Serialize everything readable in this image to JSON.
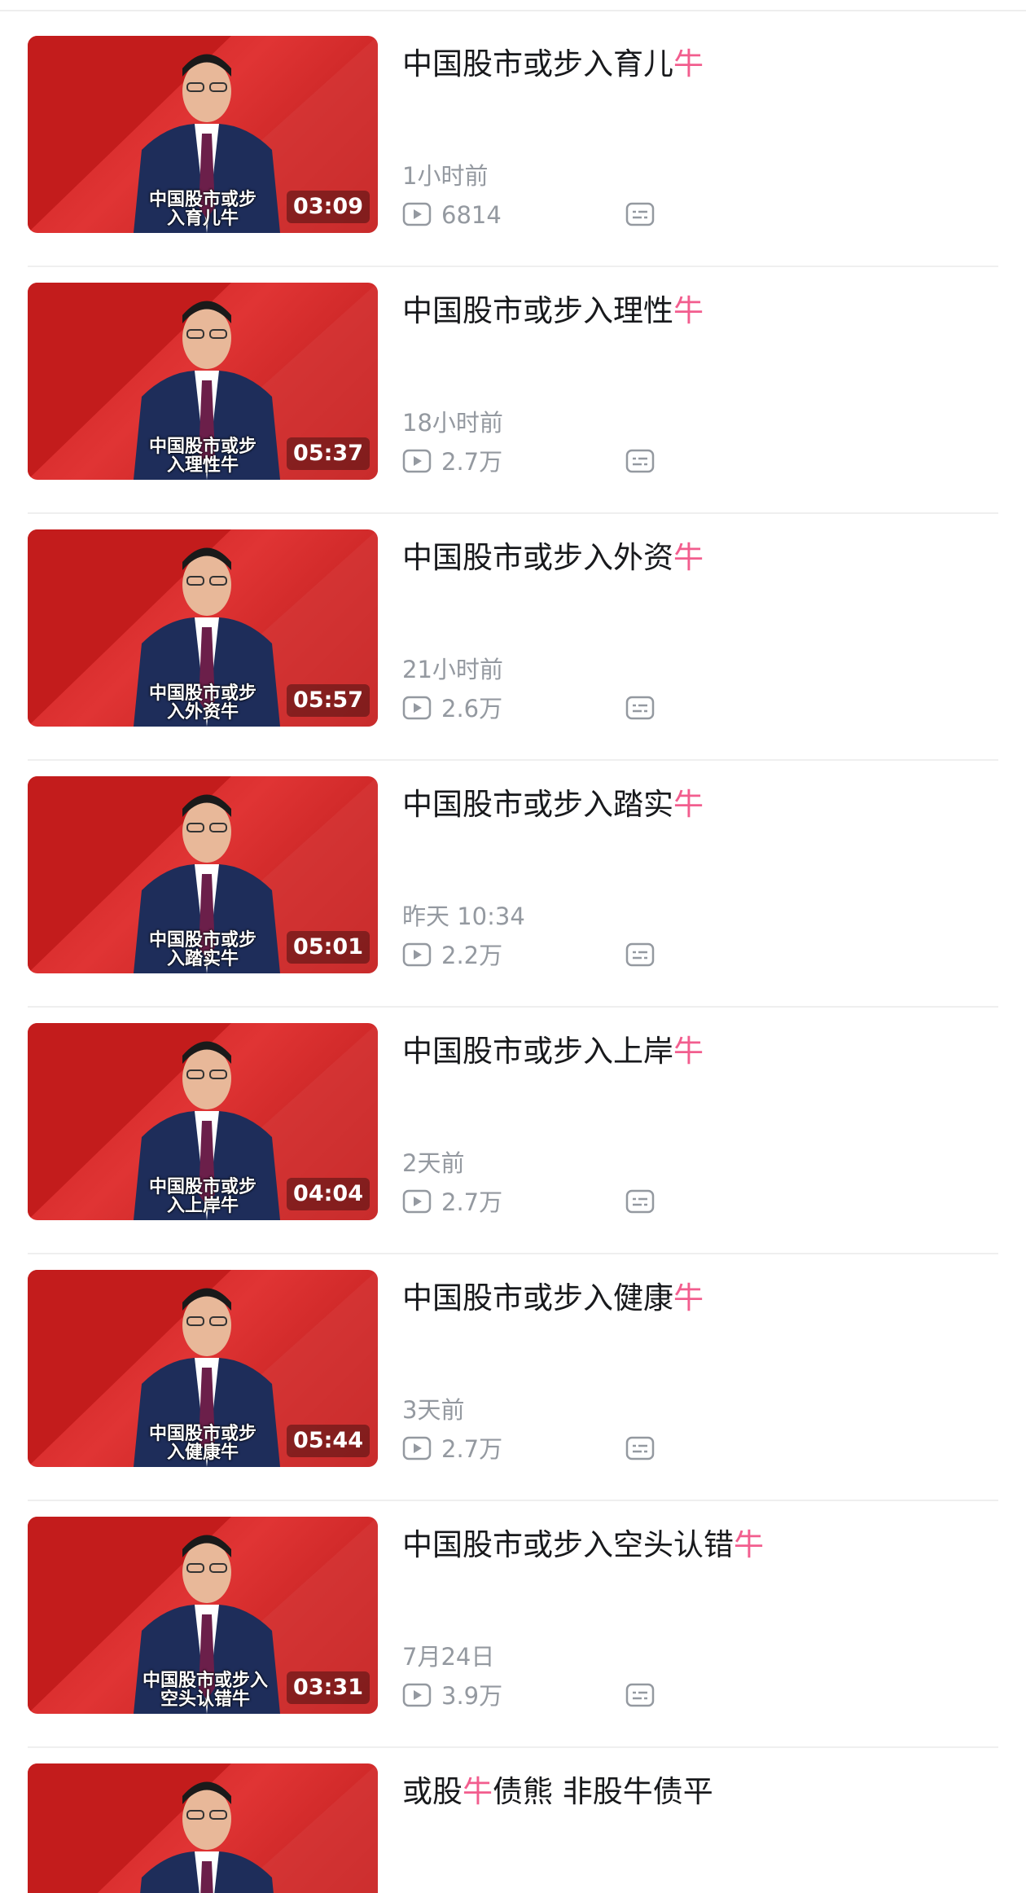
{
  "videos": [
    {
      "title_main": "中国股市或步入育儿",
      "title_hl": "牛",
      "title_tail": "",
      "caption": "中国股市或步入育儿牛",
      "duration": "03:09",
      "time": "1小时前",
      "views": "6814"
    },
    {
      "title_main": "中国股市或步入理性",
      "title_hl": "牛",
      "title_tail": "",
      "caption": "中国股市或步入理性牛",
      "duration": "05:37",
      "time": "18小时前",
      "views": "2.7万"
    },
    {
      "title_main": "中国股市或步入外资",
      "title_hl": "牛",
      "title_tail": "",
      "caption": "中国股市或步入外资牛",
      "duration": "05:57",
      "time": "21小时前",
      "views": "2.6万"
    },
    {
      "title_main": "中国股市或步入踏实",
      "title_hl": "牛",
      "title_tail": "",
      "caption": "中国股市或步入踏实牛",
      "duration": "05:01",
      "time": "昨天 10:34",
      "views": "2.2万"
    },
    {
      "title_main": "中国股市或步入上岸",
      "title_hl": "牛",
      "title_tail": "",
      "caption": "中国股市或步入上岸牛",
      "duration": "04:04",
      "time": "2天前",
      "views": "2.7万"
    },
    {
      "title_main": "中国股市或步入健康",
      "title_hl": "牛",
      "title_tail": "",
      "caption": "中国股市或步入健康牛",
      "duration": "05:44",
      "time": "3天前",
      "views": "2.7万"
    },
    {
      "title_main": "中国股市或步入空头认错",
      "title_hl": "牛",
      "title_tail": "",
      "caption": "中国股市或步入空头认错牛",
      "duration": "03:31",
      "time": "7月24日",
      "views": "3.9万"
    },
    {
      "title_main": "或股",
      "title_hl": "牛",
      "title_tail": "债熊 非股牛债平",
      "caption": "",
      "duration": "",
      "time": "",
      "views": ""
    }
  ],
  "colors": {
    "highlight": "#f25d8e",
    "title": "#18191c",
    "meta": "#9499a0",
    "thumb_red": "#d42a2a"
  },
  "icons": {
    "play": "play-count-icon",
    "subtitle": "subtitle-icon"
  }
}
